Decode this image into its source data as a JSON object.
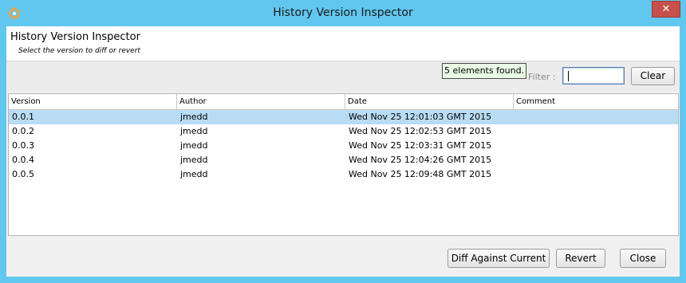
{
  "window": {
    "title": "History Version Inspector",
    "close_glyph": "✕"
  },
  "header": {
    "title": "History Version Inspector",
    "subtitle": "Select the version to diff or revert"
  },
  "toolbar": {
    "found_text": "5 elements found.",
    "filter_label": "Filter :",
    "filter_value": "",
    "clear_label": "Clear"
  },
  "table": {
    "columns": [
      "Version",
      "Author",
      "Date",
      "Comment"
    ],
    "selected_index": 0,
    "rows": [
      [
        "0.0.1",
        "jmedd",
        "Wed Nov 25 12:01:03 GMT 2015",
        ""
      ],
      [
        "0.0.2",
        "jmedd",
        "Wed Nov 25 12:02:53 GMT 2015",
        ""
      ],
      [
        "0.0.3",
        "jmedd",
        "Wed Nov 25 12:03:31 GMT 2015",
        ""
      ],
      [
        "0.0.4",
        "jmedd",
        "Wed Nov 25 12:04:26 GMT 2015",
        ""
      ],
      [
        "0.0.5",
        "jmedd",
        "Wed Nov 25 12:09:48 GMT 2015",
        ""
      ]
    ]
  },
  "footer": {
    "diff_label": "Diff Against Current",
    "revert_label": "Revert",
    "close_label": "Close"
  },
  "colors": {
    "titlebar": "#62c7ef",
    "selection": "#b9dcf5",
    "close_red": "#c7504a"
  }
}
